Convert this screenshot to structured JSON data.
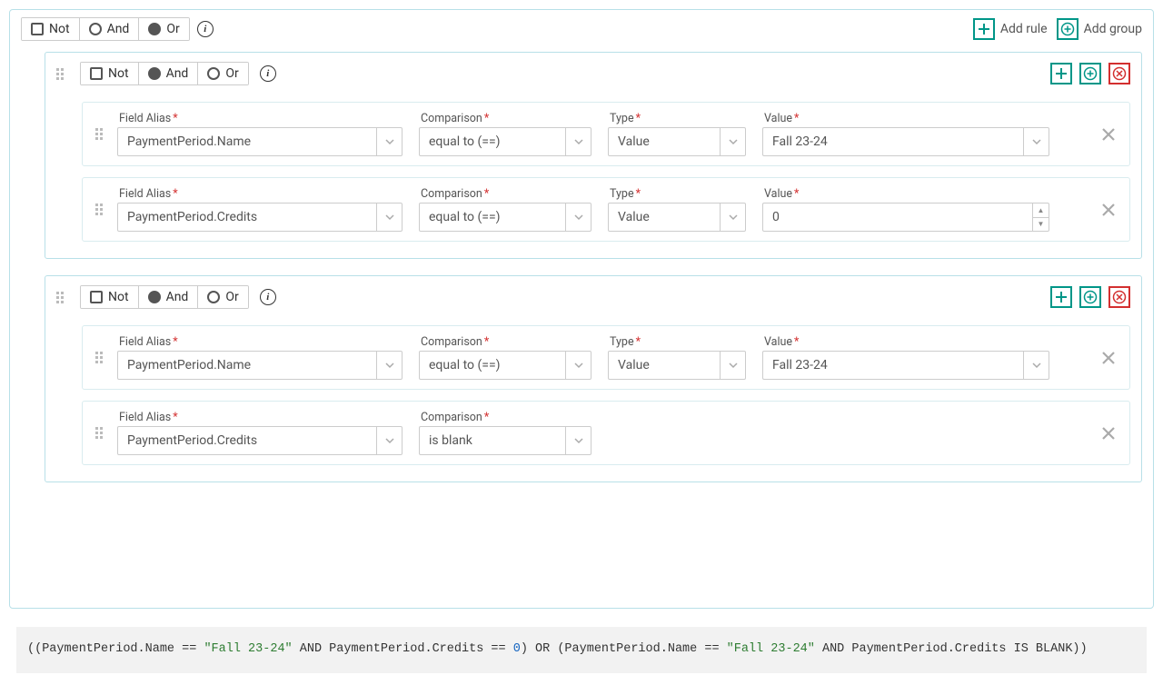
{
  "toolbar": {
    "not_label": "Not",
    "and_label": "And",
    "or_label": "Or",
    "add_rule_label": "Add rule",
    "add_group_label": "Add group"
  },
  "labels": {
    "field_alias": "Field Alias",
    "comparison": "Comparison",
    "type": "Type",
    "value": "Value"
  },
  "root_group": {
    "not_checked": false,
    "selected_logic": "Or",
    "children": [
      {
        "type": "group",
        "not_checked": false,
        "selected_logic": "And",
        "rules": [
          {
            "field": "PaymentPeriod.Name",
            "comparison": "equal to (==)",
            "vtype": "Value",
            "value": "Fall 23-24",
            "is_number": false
          },
          {
            "field": "PaymentPeriod.Credits",
            "comparison": "equal to (==)",
            "vtype": "Value",
            "value": "0",
            "is_number": true
          }
        ]
      },
      {
        "type": "group",
        "not_checked": false,
        "selected_logic": "And",
        "rules": [
          {
            "field": "PaymentPeriod.Name",
            "comparison": "equal to (==)",
            "vtype": "Value",
            "value": "Fall 23-24",
            "is_number": false
          },
          {
            "field": "PaymentPeriod.Credits",
            "comparison": "is blank",
            "vtype": null,
            "value": null,
            "is_number": false
          }
        ]
      }
    ]
  },
  "expression": {
    "parts": [
      {
        "t": "plain",
        "v": "((PaymentPeriod.Name == "
      },
      {
        "t": "str",
        "v": "\"Fall 23-24\""
      },
      {
        "t": "plain",
        "v": " AND PaymentPeriod.Credits == "
      },
      {
        "t": "num",
        "v": "0"
      },
      {
        "t": "plain",
        "v": ") OR (PaymentPeriod.Name == "
      },
      {
        "t": "str",
        "v": "\"Fall 23-24\""
      },
      {
        "t": "plain",
        "v": " AND PaymentPeriod.Credits IS BLANK))"
      }
    ]
  }
}
